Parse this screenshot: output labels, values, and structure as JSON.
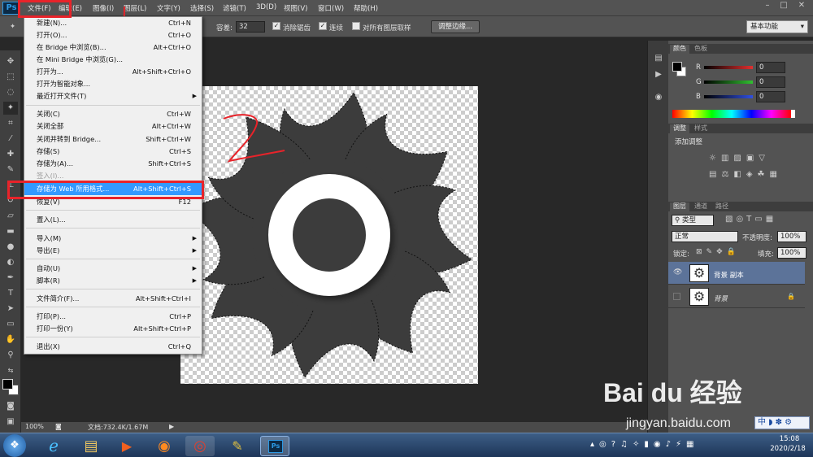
{
  "app": {
    "logo": "Ps"
  },
  "menubar": {
    "items": [
      "文件(F)",
      "编辑(E)",
      "图像(I)",
      "图层(L)",
      "文字(Y)",
      "选择(S)",
      "滤镜(T)",
      "3D(D)",
      "视图(V)",
      "窗口(W)",
      "帮助(H)"
    ],
    "window_buttons": [
      "–",
      "□",
      "✕"
    ]
  },
  "options": {
    "tolerance_label": "容差:",
    "tolerance_value": "32",
    "antialias_label": "消除锯齿",
    "contiguous_label": "连续",
    "sample_all_label": "对所有图层取样",
    "refine_edge_label": "调整边缘...",
    "workspace": "基本功能"
  },
  "file_menu": {
    "items": [
      {
        "label": "新建(N)...",
        "shortcut": "Ctrl+N"
      },
      {
        "label": "打开(O)...",
        "shortcut": "Ctrl+O"
      },
      {
        "label": "在 Bridge 中浏览(B)...",
        "shortcut": "Alt+Ctrl+O"
      },
      {
        "label": "在 Mini Bridge 中浏览(G)...",
        "shortcut": ""
      },
      {
        "label": "打开为...",
        "shortcut": "Alt+Shift+Ctrl+O"
      },
      {
        "label": "打开为智能对象...",
        "shortcut": ""
      },
      {
        "label": "最近打开文件(T)",
        "shortcut": ""
      },
      {
        "label": "关闭(C)",
        "shortcut": "Ctrl+W"
      },
      {
        "label": "关闭全部",
        "shortcut": "Alt+Ctrl+W"
      },
      {
        "label": "关闭并转到 Bridge...",
        "shortcut": "Shift+Ctrl+W"
      },
      {
        "label": "存储(S)",
        "shortcut": "Ctrl+S"
      },
      {
        "label": "存储为(A)...",
        "shortcut": "Shift+Ctrl+S"
      },
      {
        "label": "签入(I)...",
        "shortcut": ""
      },
      {
        "label": "存储为 Web 所用格式...",
        "shortcut": "Alt+Shift+Ctrl+S"
      },
      {
        "label": "恢复(V)",
        "shortcut": "F12"
      },
      {
        "label": "置入(L)...",
        "shortcut": ""
      },
      {
        "label": "导入(M)",
        "shortcut": ""
      },
      {
        "label": "导出(E)",
        "shortcut": ""
      },
      {
        "label": "自动(U)",
        "shortcut": ""
      },
      {
        "label": "脚本(R)",
        "shortcut": ""
      },
      {
        "label": "文件简介(F)...",
        "shortcut": "Alt+Shift+Ctrl+I"
      },
      {
        "label": "打印(P)...",
        "shortcut": "Ctrl+P"
      },
      {
        "label": "打印一份(Y)",
        "shortcut": "Alt+Shift+Ctrl+P"
      },
      {
        "label": "退出(X)",
        "shortcut": "Ctrl+Q"
      }
    ]
  },
  "annotation": {
    "text": "2"
  },
  "status": {
    "zoom": "100%",
    "doc": "文档:732.4K/1.67M"
  },
  "color_panel": {
    "tabs": [
      "颜色",
      "色板"
    ],
    "channels": [
      {
        "label": "R",
        "value": "0",
        "color": "#e03030"
      },
      {
        "label": "G",
        "value": "0",
        "color": "#30c030"
      },
      {
        "label": "B",
        "value": "0",
        "color": "#3050e0"
      }
    ]
  },
  "adjust_panel": {
    "tabs": [
      "调整",
      "样式"
    ],
    "title": "添加调整"
  },
  "layers_panel": {
    "tabs": [
      "图层",
      "通道",
      "路径"
    ],
    "kind": "类型",
    "blend": "正常",
    "opacity_label": "不透明度:",
    "opacity": "100%",
    "lock_label": "锁定:",
    "fill_label": "填充:",
    "fill": "100%",
    "layers": [
      {
        "name": "背景 副本",
        "selected": true
      },
      {
        "name": "背景",
        "selected": false
      }
    ]
  },
  "watermark": {
    "logo": "Bai du 经验",
    "url": "jingyan.baidu.com"
  },
  "ime": {
    "text": "中"
  },
  "taskbar": {
    "time": "15:08",
    "date": "2020/2/18"
  },
  "accent": "#e8232a"
}
